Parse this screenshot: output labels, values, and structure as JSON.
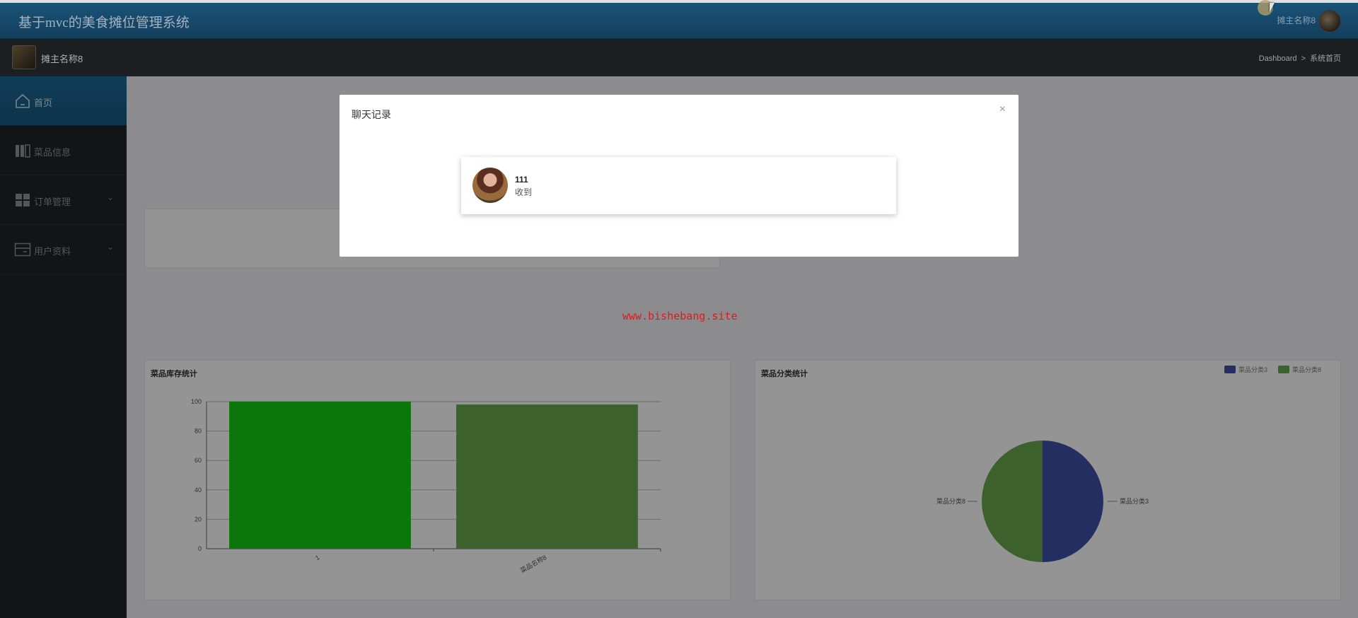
{
  "header": {
    "app_title": "基于mvc的美食摊位管理系统",
    "user_name": "摊主名称8"
  },
  "subheader": {
    "brand_name": "摊主名称8",
    "breadcrumb": [
      "Dashboard",
      "系统首页"
    ],
    "breadcrumb_sep": ">"
  },
  "sidebar": {
    "items": [
      {
        "label": "首页",
        "icon": "home-icon",
        "active": true
      },
      {
        "label": "菜品信息",
        "icon": "book-icon",
        "active": false
      },
      {
        "label": "订单管理",
        "icon": "grid-icon",
        "active": false,
        "expandable": true
      },
      {
        "label": "用户资料",
        "icon": "card-icon",
        "active": false,
        "expandable": true
      }
    ]
  },
  "watermark": "www.bishebang.site",
  "modal": {
    "title": "聊天记录",
    "close_glyph": "×",
    "messages": [
      {
        "name": "111",
        "text": "收到"
      }
    ]
  },
  "charts": {
    "stock": {
      "title": "菜品库存统计"
    },
    "category": {
      "title": "菜品分类统计"
    }
  },
  "chart_data": [
    {
      "type": "bar",
      "title": "菜品库存统计",
      "categories": [
        "1",
        "菜品名称8"
      ],
      "values": [
        100,
        98
      ],
      "bar_colors": [
        "#13cc13",
        "#6aa84f"
      ],
      "ylim": [
        0,
        100
      ],
      "yticks": [
        0,
        20,
        40,
        60,
        80,
        100
      ],
      "grid": true
    },
    {
      "type": "pie",
      "title": "菜品分类统计",
      "labels": [
        "菜品分类3",
        "菜品分类8"
      ],
      "values": [
        50,
        50
      ],
      "colors": [
        "#3f51a8",
        "#6aa84f"
      ],
      "legend": "top-right"
    }
  ]
}
